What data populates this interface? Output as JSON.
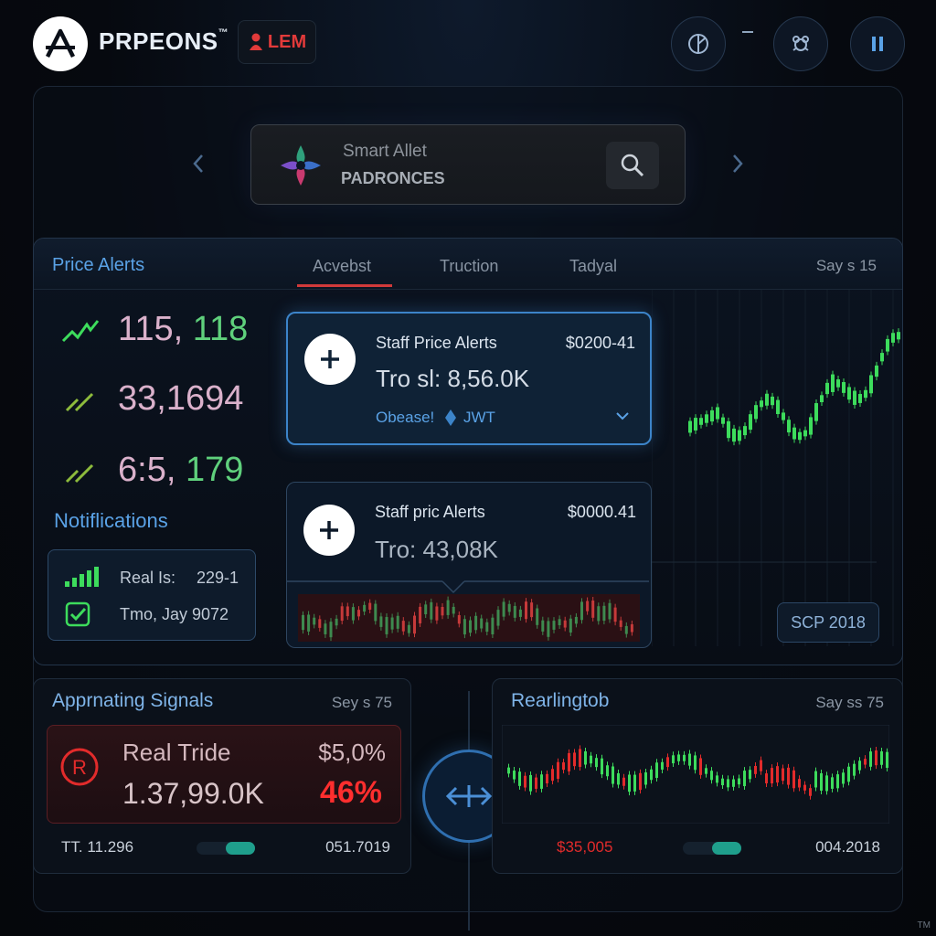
{
  "header": {
    "brand": "PRPEONS",
    "brand_tm": "™",
    "badge_label": "LEM"
  },
  "search": {
    "title": "Smart Allet",
    "subtitle": "PADRONCES"
  },
  "alerts_panel": {
    "title": "Price Alerts",
    "tabs": [
      {
        "label": "Acvebst",
        "active": true
      },
      {
        "label": "Truction",
        "active": false
      },
      {
        "label": "Tadyal",
        "active": false
      }
    ],
    "right_label": "Say s 15",
    "prices": [
      {
        "left": "115,",
        "right": "118",
        "icon": "trend-up-icon"
      },
      {
        "left": "33,1694",
        "right": "",
        "icon": "arrow-up-right-icon"
      },
      {
        "left": "6:5,",
        "right": "179",
        "icon": "arrow-up-right-icon"
      }
    ],
    "notifications": {
      "title": "Notiflications",
      "row1_label": "Real Is:",
      "row1_value": "229-1",
      "row2_label": "Tmo, Jay 9072"
    },
    "cards": [
      {
        "title": "Staff Price Alerts",
        "amount": "$0200-41",
        "value": "Tro sl:  8,56.0K",
        "sub_a": "Obease!",
        "sub_b": "JWT"
      },
      {
        "title": "Staff pric Alerts",
        "amount": "$0000.41",
        "value": "Tro: 43,08K"
      }
    ],
    "scp_badge": "SCP 2018"
  },
  "signals_panel": {
    "title": "Apprnating Signals",
    "right_label": "Sey s 75",
    "trade_label": "Real  Tride",
    "trade_pct_top": "$5,0%",
    "trade_value": "1.37,99.0K",
    "trade_pct": "46%",
    "footer_left": "TT. 11.296",
    "footer_right": "051.7019"
  },
  "chart_panel": {
    "title": "Rearlingtob",
    "right_label": "Say ss 75",
    "footer_left": "$35,005",
    "footer_right": "004.2018"
  },
  "watermark": "TM",
  "colors": {
    "accent_blue": "#3c84c9",
    "up_green": "#3ddc5c",
    "down_red": "#e22b2b"
  }
}
